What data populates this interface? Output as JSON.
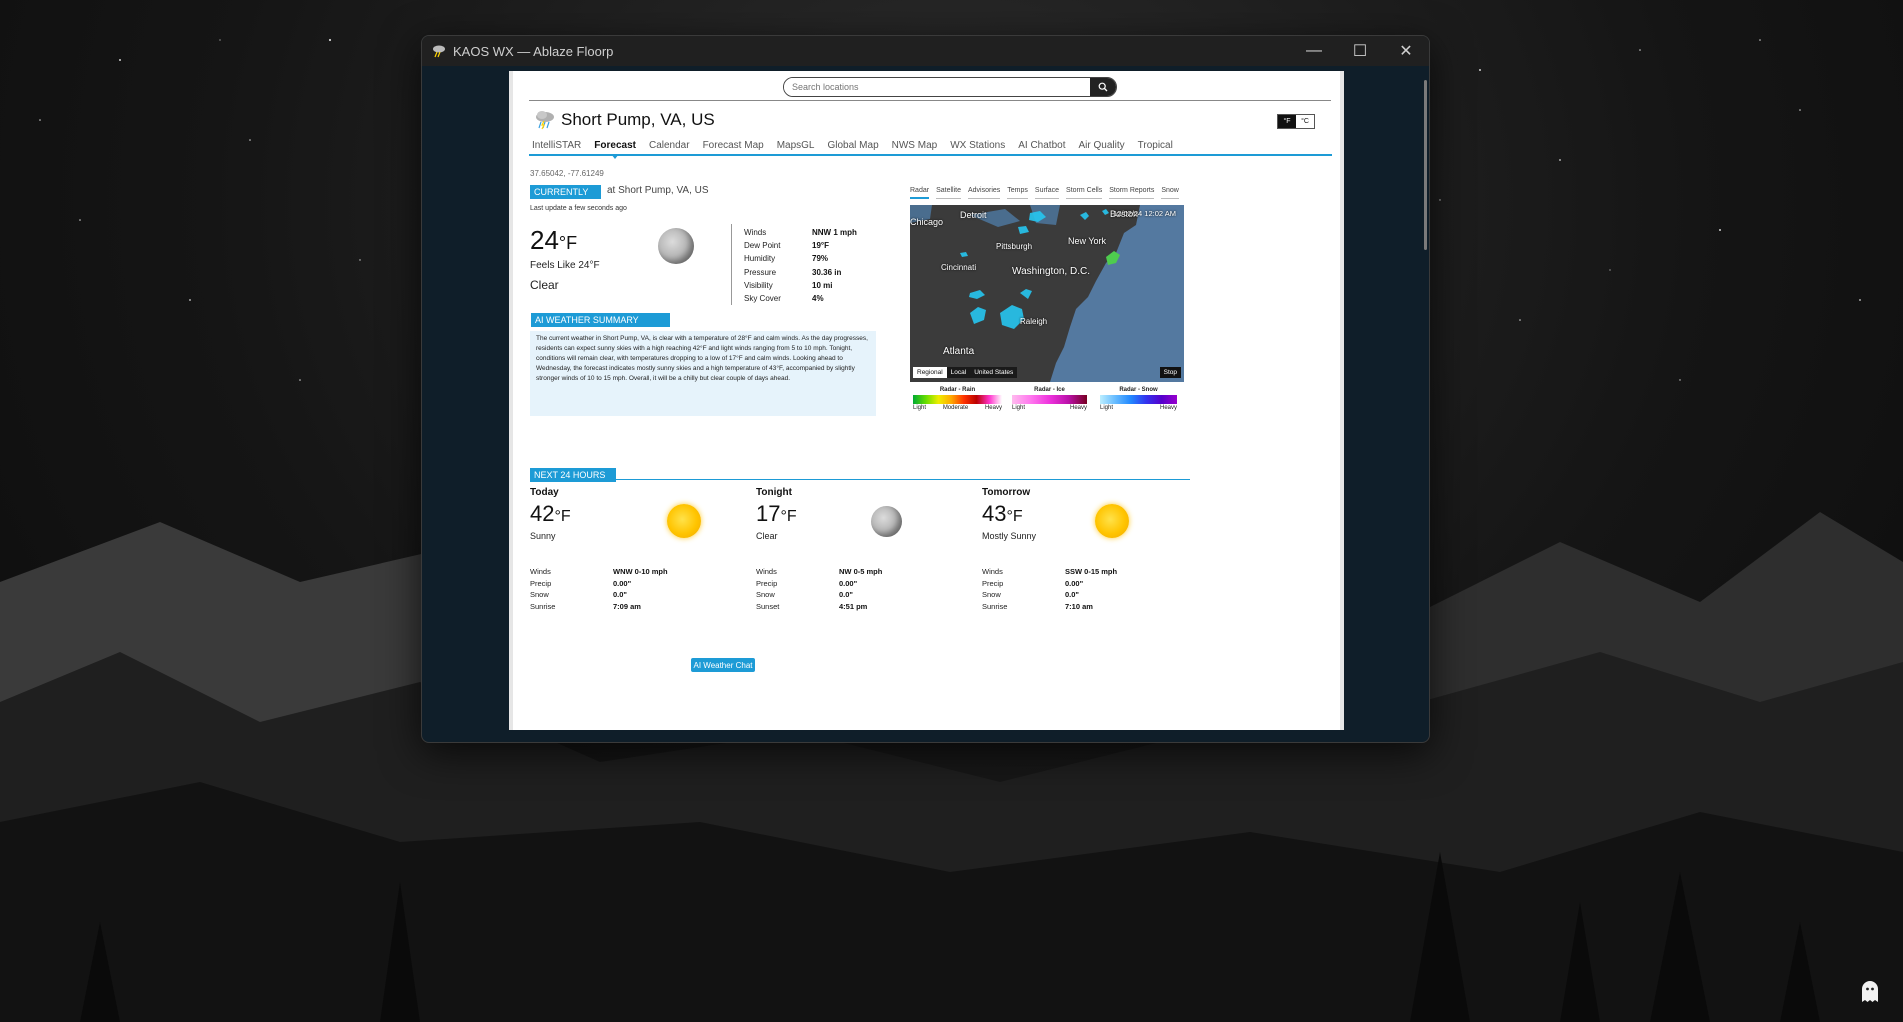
{
  "window": {
    "title": "KAOS WX — Ablaze Floorp"
  },
  "search": {
    "placeholder": "Search locations"
  },
  "location": {
    "name": "Short Pump, VA, US",
    "coords": "37.65042, -77.61249"
  },
  "units": {
    "f": "°F",
    "c": "°C"
  },
  "tabs": [
    "IntelliSTAR",
    "Forecast",
    "Calendar",
    "Forecast Map",
    "MapsGL",
    "Global Map",
    "NWS Map",
    "WX Stations",
    "AI Chatbot",
    "Air Quality",
    "Tropical"
  ],
  "active_tab": "Forecast",
  "current": {
    "badge": "CURRENTLY",
    "at": "at Short Pump, VA, US",
    "last_update": "Last update a few seconds ago",
    "temp": "24",
    "temp_unit": "°F",
    "feels_like": "Feels Like 24°F",
    "condition": "Clear",
    "stats": [
      {
        "label": "Winds",
        "value": "NNW 1 mph"
      },
      {
        "label": "Dew Point",
        "value": "19°F"
      },
      {
        "label": "Humidity",
        "value": "79%"
      },
      {
        "label": "Pressure",
        "value": "30.36 in"
      },
      {
        "label": "Visibility",
        "value": "10 mi"
      },
      {
        "label": "Sky Cover",
        "value": "4%"
      }
    ]
  },
  "ai": {
    "badge": "AI WEATHER SUMMARY (BETA)",
    "summary": "The current weather in Short Pump, VA, is clear with a temperature of 28°F and calm winds. As the day progresses, residents can expect sunny skies with a high reaching 42°F and light winds ranging from 5 to 10 mph. Tonight, conditions will remain clear, with temperatures dropping to a low of 17°F and calm winds. Looking ahead to Wednesday, the forecast indicates mostly sunny skies and a high temperature of 43°F, accompanied by slightly stronger winds of 10 to 15 mph. Overall, it will be a chilly but clear couple of days ahead.",
    "chat_button": "AI Weather Chat"
  },
  "map": {
    "tabs": [
      "Radar",
      "Satellite",
      "Advisories",
      "Temps",
      "Surface",
      "Storm Cells",
      "Storm Reports",
      "Snow"
    ],
    "active_tab": "Radar",
    "timestamp": "12/02/24 12:02 AM",
    "cities": [
      "Chicago",
      "Detroit",
      "Boston",
      "New York",
      "Pittsburgh",
      "Cincinnati",
      "Washington, D.C.",
      "Raleigh",
      "Atlanta"
    ],
    "controls": [
      "Regional",
      "Local",
      "United States"
    ],
    "active_control": "Regional",
    "stop_label": "Stop",
    "legends": [
      {
        "title": "Radar - Rain",
        "labels": [
          "Light",
          "Moderate",
          "Heavy"
        ]
      },
      {
        "title": "Radar - Ice",
        "labels": [
          "Light",
          "Heavy"
        ]
      },
      {
        "title": "Radar - Snow",
        "labels": [
          "Light",
          "Heavy"
        ]
      }
    ]
  },
  "next24": {
    "badge": "NEXT 24 HOURS",
    "periods": [
      {
        "name": "Today",
        "temp": "42",
        "unit": "°F",
        "condition": "Sunny",
        "icon": "sun-icon",
        "stats": [
          {
            "label": "Winds",
            "value": "WNW 0-10 mph"
          },
          {
            "label": "Precip",
            "value": "0.00\""
          },
          {
            "label": "Snow",
            "value": "0.0\""
          },
          {
            "label": "Sunrise",
            "value": "7:09 am"
          }
        ]
      },
      {
        "name": "Tonight",
        "temp": "17",
        "unit": "°F",
        "condition": "Clear",
        "icon": "moon-icon",
        "stats": [
          {
            "label": "Winds",
            "value": "NW 0-5 mph"
          },
          {
            "label": "Precip",
            "value": "0.00\""
          },
          {
            "label": "Snow",
            "value": "0.0\""
          },
          {
            "label": "Sunset",
            "value": "4:51 pm"
          }
        ]
      },
      {
        "name": "Tomorrow",
        "temp": "43",
        "unit": "°F",
        "condition": "Mostly Sunny",
        "icon": "sun-icon",
        "stats": [
          {
            "label": "Winds",
            "value": "SSW 0-15 mph"
          },
          {
            "label": "Precip",
            "value": "0.00\""
          },
          {
            "label": "Snow",
            "value": "0.0\""
          },
          {
            "label": "Sunrise",
            "value": "7:10 am"
          }
        ]
      }
    ]
  },
  "colors": {
    "accent": "#1d9bd6",
    "window_bg": "#0f1e29",
    "titlebar": "#202020"
  }
}
